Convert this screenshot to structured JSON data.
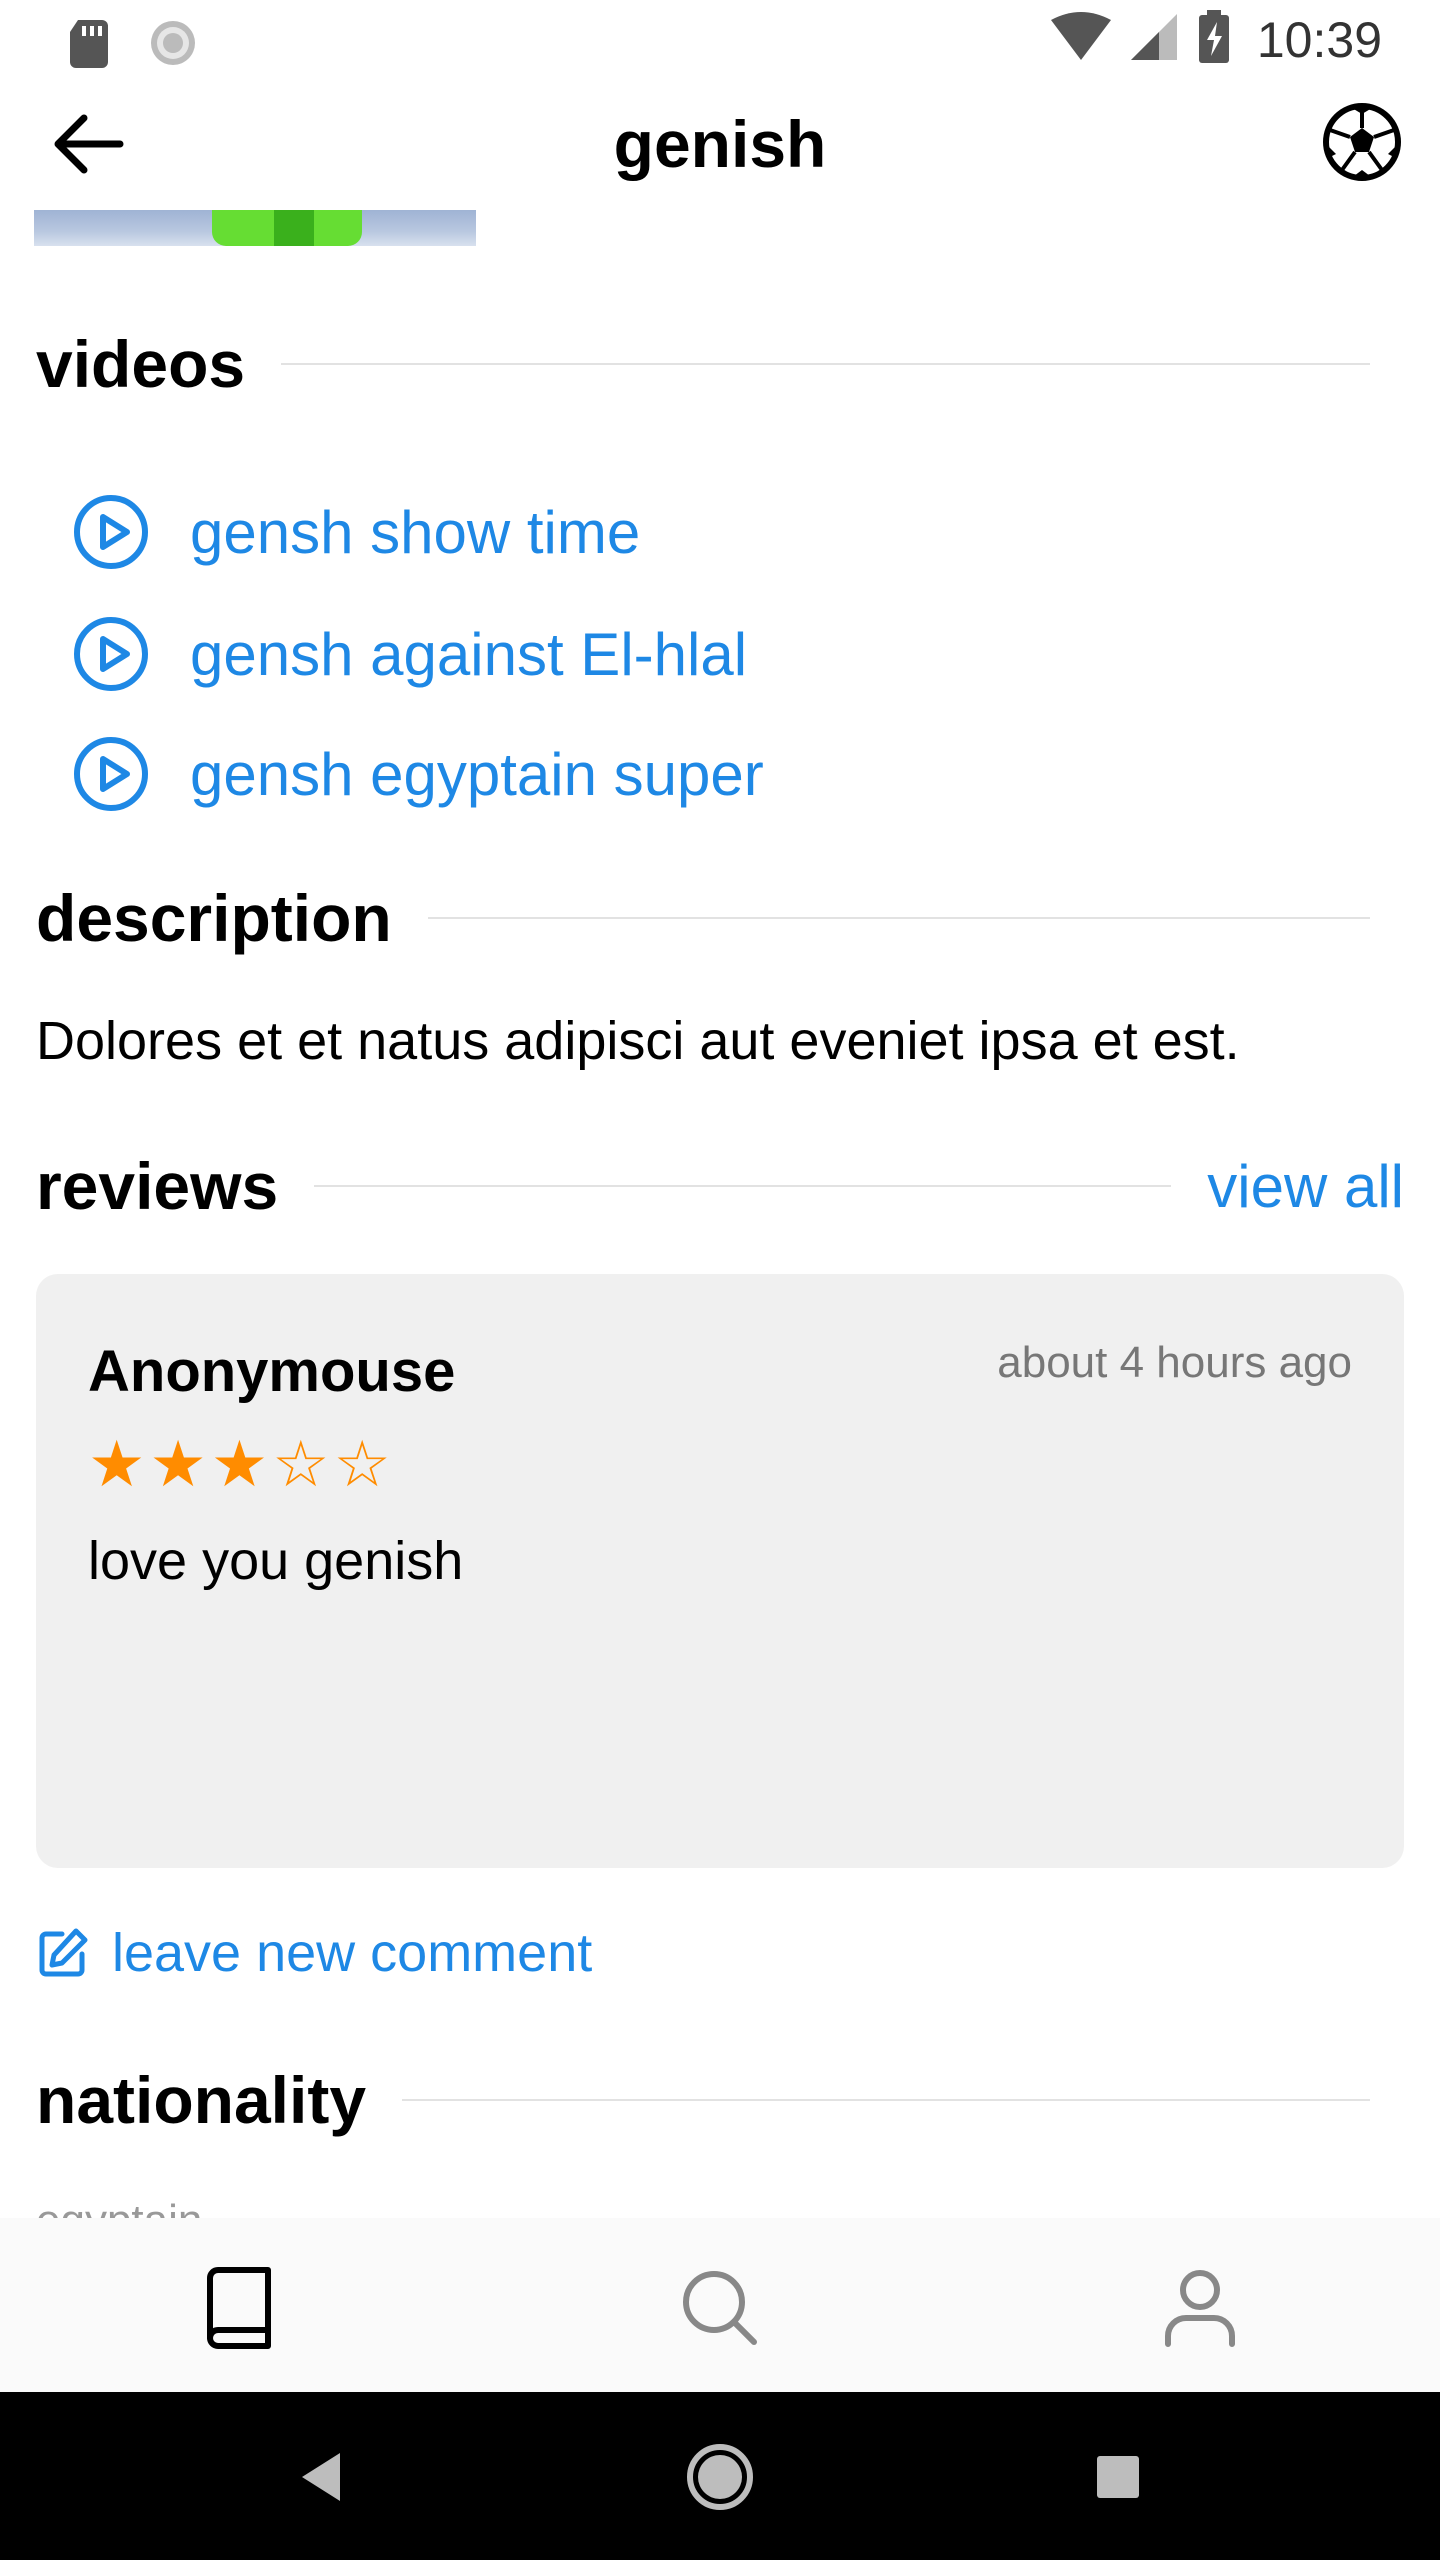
{
  "status_bar": {
    "time": "10:39",
    "icons": [
      "sd-card-icon",
      "sync-icon",
      "wifi-icon",
      "signal-icon",
      "battery-charging-icon"
    ]
  },
  "app_bar": {
    "title": "genish",
    "back_icon": "arrow-left-icon",
    "action_icon": "soccer-ball-icon"
  },
  "sections": {
    "videos": {
      "title": "videos"
    },
    "description": {
      "title": "description"
    },
    "reviews": {
      "title": "reviews",
      "view_all": "view all"
    },
    "nationality": {
      "title": "nationality"
    }
  },
  "videos": [
    {
      "label": "gensh show time",
      "icon": "play-circle-icon"
    },
    {
      "label": "gensh against El-hlal",
      "icon": "play-circle-icon"
    },
    {
      "label": "gensh egyptain super",
      "icon": "play-circle-icon"
    }
  ],
  "description": {
    "text": "Dolores et et natus adipisci aut eveniet ipsa et est."
  },
  "review": {
    "author": "Anonymouse",
    "time": "about 4 hours ago",
    "rating": 3,
    "max_rating": 5,
    "text": "love you genish"
  },
  "leave_comment": {
    "label": "leave new comment",
    "icon": "edit-icon"
  },
  "nationality": {
    "value": "egyptain"
  },
  "bottom_nav": [
    {
      "name": "library",
      "icon": "book-icon",
      "active": true
    },
    {
      "name": "search",
      "icon": "search-icon",
      "active": false
    },
    {
      "name": "profile",
      "icon": "user-icon",
      "active": false
    }
  ],
  "system_nav": [
    "back-triangle-icon",
    "home-circle-icon",
    "recents-square-icon"
  ],
  "colors": {
    "accent": "#1e88e5",
    "star": "#ff8c00",
    "card_bg": "#f0f0f0",
    "muted_text": "#777777",
    "divider": "#e2e2e2"
  }
}
